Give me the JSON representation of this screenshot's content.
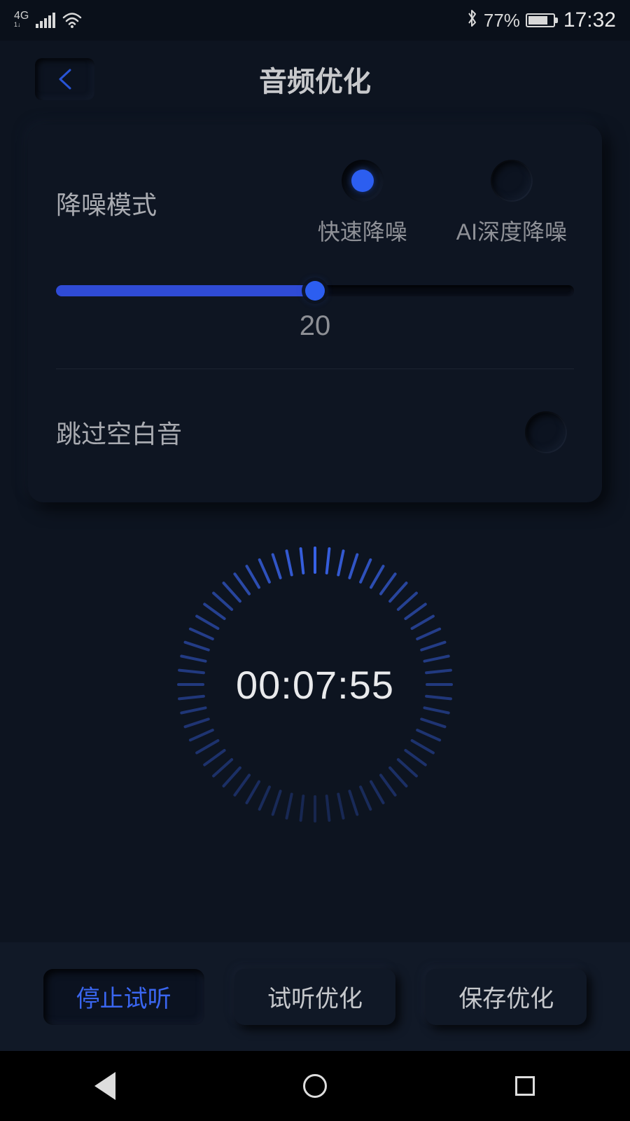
{
  "status": {
    "network": "4G",
    "battery_pct": "77%",
    "time": "17:32"
  },
  "header": {
    "title": "音频优化"
  },
  "noise": {
    "label": "降噪模式",
    "options": {
      "fast": "快速降噪",
      "ai": "AI深度降噪"
    },
    "slider_value": "20"
  },
  "skip": {
    "label": "跳过空白音"
  },
  "timer": {
    "display": "00:07:55"
  },
  "buttons": {
    "stop": "停止试听",
    "preview": "试听优化",
    "save": "保存优化"
  }
}
